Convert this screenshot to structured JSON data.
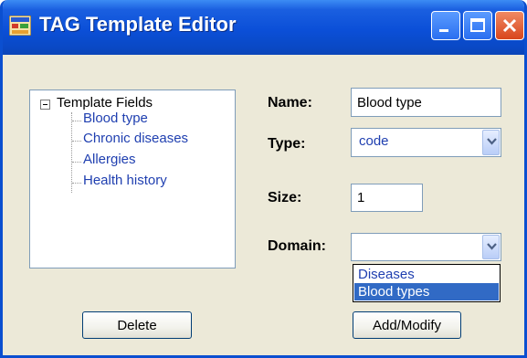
{
  "window": {
    "title": "TAG Template Editor",
    "controls": [
      "minimize-icon",
      "maximize-icon",
      "close-icon"
    ]
  },
  "tree": {
    "root_label": "Template Fields",
    "children": [
      "Blood type",
      "Chronic diseases",
      "Allergies",
      "Health history"
    ]
  },
  "form": {
    "name_label": "Name:",
    "name_value": "Blood type",
    "type_label": "Type:",
    "type_value": "code",
    "size_label": "Size:",
    "size_value": "1",
    "domain_label": "Domain:",
    "domain_value": "",
    "domain_options": [
      "Diseases",
      "Blood types"
    ],
    "domain_highlighted": "Blood types"
  },
  "buttons": {
    "delete": "Delete",
    "add_modify": "Add/Modify"
  },
  "colors": {
    "titlebar": "#0b4fd8",
    "window_bg": "#ece9d8",
    "tree_text": "#1f3fb0",
    "selection": "#316ac5"
  }
}
